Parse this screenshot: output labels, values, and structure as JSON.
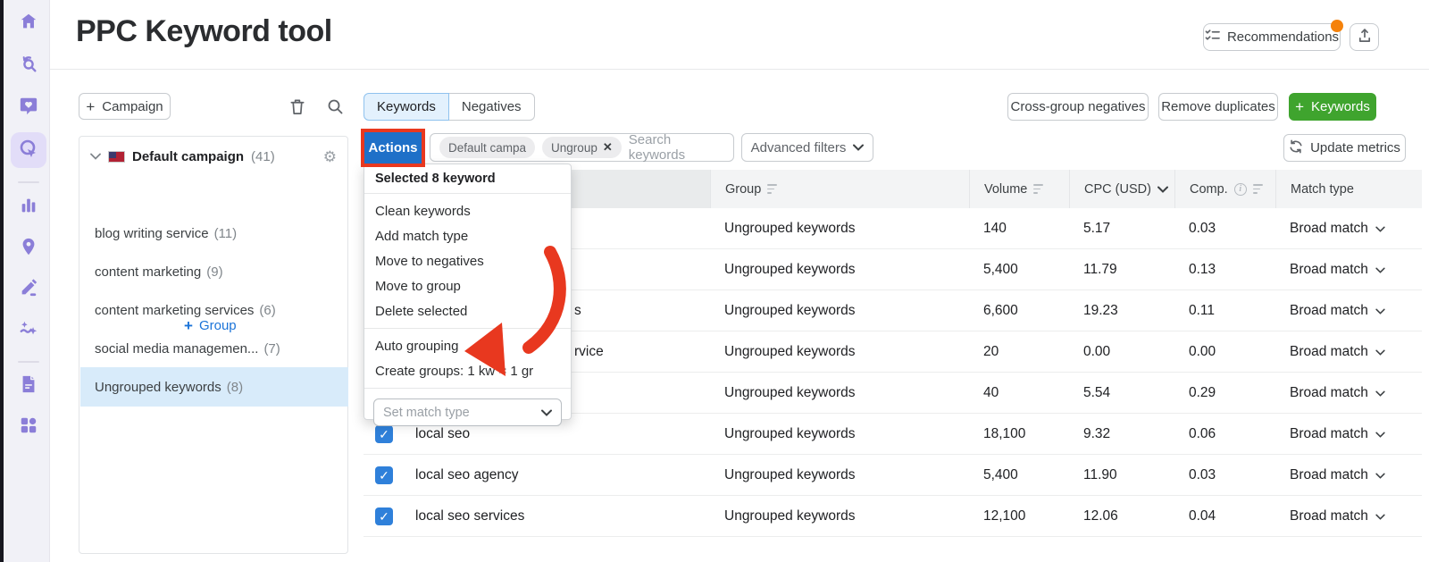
{
  "app": {
    "title": "PPC Keyword tool"
  },
  "header": {
    "recommendations_label": "Recommendations",
    "notification_dot_color": "#f5820b"
  },
  "sidebar": {
    "icons": [
      "home",
      "rank-tracker",
      "feedback-heart",
      "ppc-tool-active",
      "analytics-bars",
      "local-marketing-pin",
      "content-editor-pencil",
      "insights-sparkles",
      "report-document",
      "apps-grid"
    ]
  },
  "left_panel": {
    "campaign_button_label": "Campaign",
    "tree": {
      "campaign_name": "Default campaign",
      "campaign_count": "(41)",
      "add_group_label": "Group",
      "groups": [
        {
          "name": "blog writing service",
          "count": "(11)"
        },
        {
          "name": "content marketing",
          "count": "(9)"
        },
        {
          "name": "content marketing services",
          "count": "(6)"
        },
        {
          "name": "social media managemen...",
          "count": "(7)"
        },
        {
          "name": "Ungrouped keywords",
          "count": "(8)",
          "selected": true
        }
      ]
    }
  },
  "toolbar": {
    "tabs": {
      "keywords": "Keywords",
      "negatives": "Negatives",
      "active": "Keywords"
    },
    "actions_label": "Actions",
    "chips": {
      "campaign": "Default campa",
      "group": "Ungroup"
    },
    "search_placeholder": "Search keywords",
    "advanced_filters_label": "Advanced filters",
    "cross_group_label": "Cross-group negatives",
    "remove_duplicates_label": "Remove duplicates",
    "add_keywords_label": "Keywords",
    "update_metrics_label": "Update metrics"
  },
  "actions_menu": {
    "header": "Selected 8 keyword",
    "items": [
      "Clean keywords",
      "Add match type",
      "Move to negatives",
      "Move to group",
      "Delete selected"
    ],
    "grouping_items": [
      "Auto grouping",
      "Create groups: 1 kw = 1 gr"
    ],
    "set_match_type_placeholder": "Set match type"
  },
  "table": {
    "columns": {
      "group": "Group",
      "volume": "Volume",
      "cpc": "CPC (USD)",
      "comp": "Comp.",
      "match": "Match type"
    },
    "rows": [
      {
        "keyword": "",
        "group": "Ungrouped keywords",
        "volume": "140",
        "cpc": "5.17",
        "comp": "0.03",
        "match": "Broad match"
      },
      {
        "keyword": "",
        "group": "Ungrouped keywords",
        "volume": "5,400",
        "cpc": "11.79",
        "comp": "0.13",
        "match": "Broad match"
      },
      {
        "keyword": "s",
        "group": "Ungrouped keywords",
        "volume": "6,600",
        "cpc": "19.23",
        "comp": "0.11",
        "match": "Broad match"
      },
      {
        "keyword": "rvice",
        "group": "Ungrouped keywords",
        "volume": "20",
        "cpc": "0.00",
        "comp": "0.00",
        "match": "Broad match"
      },
      {
        "keyword": "",
        "group": "Ungrouped keywords",
        "volume": "40",
        "cpc": "5.54",
        "comp": "0.29",
        "match": "Broad match"
      },
      {
        "keyword": "local seo",
        "group": "Ungrouped keywords",
        "volume": "18,100",
        "cpc": "9.32",
        "comp": "0.06",
        "match": "Broad match",
        "checked": true
      },
      {
        "keyword": "local seo agency",
        "group": "Ungrouped keywords",
        "volume": "5,400",
        "cpc": "11.90",
        "comp": "0.03",
        "match": "Broad match",
        "checked": true
      },
      {
        "keyword": "local seo services",
        "group": "Ungrouped keywords",
        "volume": "12,100",
        "cpc": "12.06",
        "comp": "0.04",
        "match": "Broad match",
        "checked": true
      }
    ]
  },
  "annotation": {
    "highlight_color": "#e8381f",
    "arrow_target": "Auto grouping"
  },
  "colors": {
    "accent_blue": "#1e70c8",
    "green": "#3fa42e",
    "annotation_red": "#e8381f",
    "sidebar_purple": "#8b7ed8",
    "selected_row_blue": "#d8ebfa",
    "tab_active_bg": "#e3f1fd",
    "checkbox_blue": "#2f80da",
    "link_blue": "#1a73d8",
    "notification_orange": "#f5820b"
  }
}
